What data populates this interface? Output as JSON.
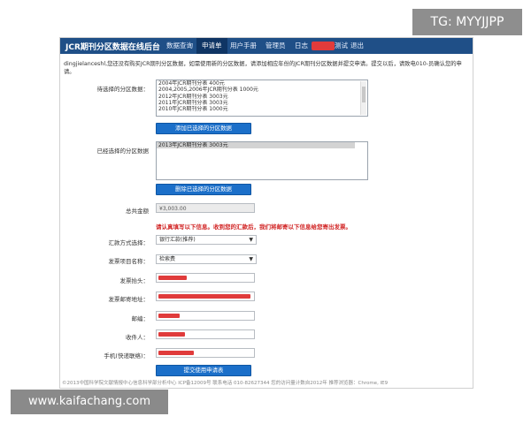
{
  "watermarks": {
    "top_right": "TG: MYYJJPP",
    "bottom_left": "www.kaifachang.com"
  },
  "header": {
    "title": "JCR期刊分区数据在线后台",
    "nav": [
      "数据查询",
      "申请单",
      "用户手册",
      "管理员",
      "日志",
      "测试",
      "退出"
    ],
    "active_index": 1
  },
  "intro_text": "dingjielanceshl,您还没有购买JCR期刊分区数据，如需使用新的分区数据，请添加相应年份的JCR期刊分区数据并提交申请。提交以后，请致电010-员确认您的申请。",
  "available": {
    "label": "待选择的分区数据：",
    "items": [
      "2004年JCR期刊分表 400元",
      "2004,2005,2006年JCR期刊分表 1000元",
      "2012年JCR期刊分表 3003元",
      "2011年JCR期刊分表 3003元",
      "2010年JCR期刊分表 1000元"
    ],
    "add_button": "添加已选择的分区数据"
  },
  "selected": {
    "label": "已经选择的分区数据",
    "items": [
      "2013年JCR期刊分表 3003元"
    ],
    "remove_button": "删除已选择的分区数据"
  },
  "total": {
    "label": "总共金额",
    "value": "¥3,003.00"
  },
  "notice": "请认真填写以下信息。收到您的汇款后，我们将邮寄以下信息给您寄出发票。",
  "form": {
    "payment_label": "汇款方式选择：",
    "payment_value": "银行汇款(推荐)",
    "invoice_item_label": "发票项目名称：",
    "invoice_item_value": "检索费",
    "invoice_title_label": "发票抬头：",
    "mail_address_label": "发票邮寄地址：",
    "postcode_label": "邮编：",
    "recipient_label": "收件人：",
    "phone_label": "手机(快递联络)：",
    "submit_button": "提交使用申请表"
  },
  "footer": "©2013中国科学院文献情报中心信息科学部分析中心 ICP备12009号 联系电话 010-82627344 您的访问量计数自2012年 推荐浏览器：Chrome, IE9"
}
